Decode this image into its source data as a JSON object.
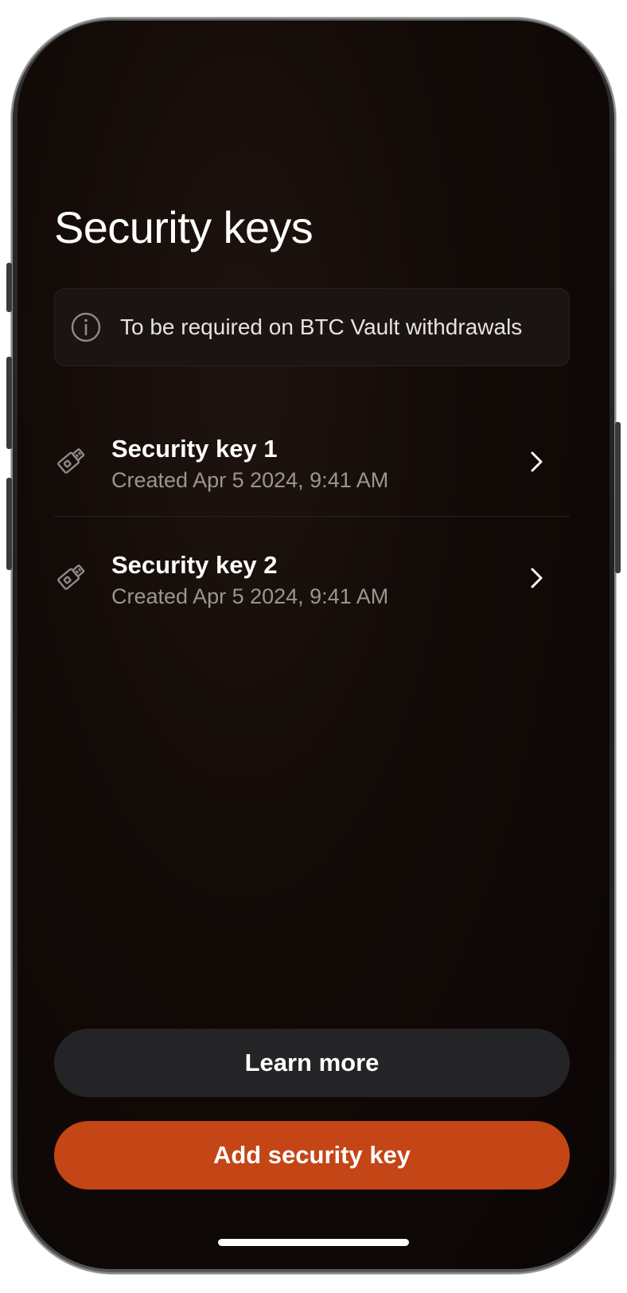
{
  "screen": {
    "title": "Security keys"
  },
  "info_banner": {
    "icon": "info-icon",
    "text": "To be required on BTC Vault withdrawals"
  },
  "security_keys": [
    {
      "icon": "usb-key-icon",
      "name": "Security key 1",
      "created": "Created Apr 5 2024, 9:41 AM"
    },
    {
      "icon": "usb-key-icon",
      "name": "Security key 2",
      "created": "Created Apr 5 2024, 9:41 AM"
    }
  ],
  "actions": {
    "learn_more_label": "Learn more",
    "add_key_label": "Add security key"
  },
  "colors": {
    "background": "#0f0806",
    "primary_accent": "#c44516",
    "secondary_button": "#242326",
    "muted_text": "#9b9592"
  }
}
